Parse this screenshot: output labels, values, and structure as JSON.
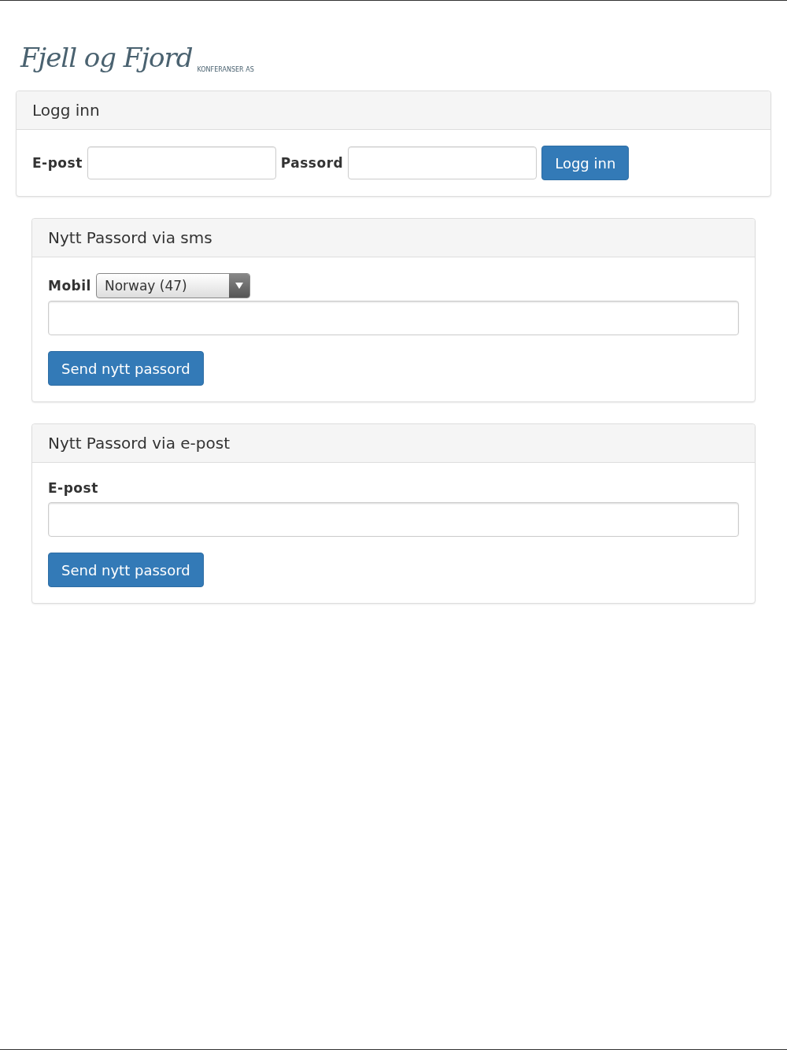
{
  "logo": {
    "name": "Fjell og Fjord",
    "tagline": "KONFERANSER AS"
  },
  "login": {
    "title": "Logg inn",
    "email_label": "E-post",
    "password_label": "Passord",
    "button": "Logg inn"
  },
  "sms_reset": {
    "title": "Nytt Passord via sms",
    "mobile_label": "Mobil",
    "country": "Norway (47)",
    "button": "Send nytt passord"
  },
  "email_reset": {
    "title": "Nytt Passord via e-post",
    "email_label": "E-post",
    "button": "Send nytt passord"
  }
}
